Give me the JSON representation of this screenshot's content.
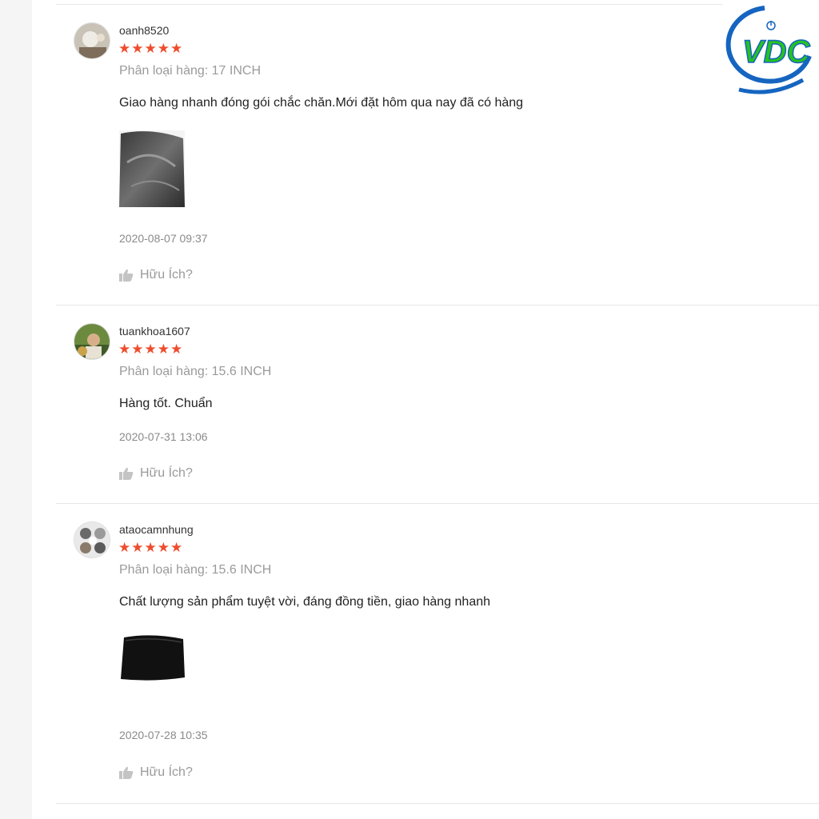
{
  "brand": {
    "logo_text": "VDC"
  },
  "helpful_label": "Hữu Ích?",
  "reviews": [
    {
      "username": "oanh8520",
      "stars": "★★★★★",
      "rating": 5,
      "variant": "Phân loại hàng: 17 INCH",
      "comment": "Giao hàng nhanh đóng gói chắc chăn.Mới đặt hôm qua nay đã có hàng",
      "timestamp": "2020-08-07 09:37"
    },
    {
      "username": "tuankhoa1607",
      "stars": "★★★★★",
      "rating": 5,
      "variant": "Phân loại hàng: 15.6 INCH",
      "comment": "Hàng tốt. Chuẩn",
      "timestamp": "2020-07-31 13:06"
    },
    {
      "username": "ataocamnhung",
      "stars": "★★★★★",
      "rating": 5,
      "variant": "Phân loại hàng: 15.6 INCH",
      "comment": "Chất lượng sản phẩm tuyệt vời, đáng đồng tiền, giao hàng nhanh",
      "timestamp": "2020-07-28 10:35"
    }
  ],
  "colors": {
    "star": "#ee4d2d",
    "logo_blue": "#1565c0",
    "logo_green": "#27c21e"
  }
}
